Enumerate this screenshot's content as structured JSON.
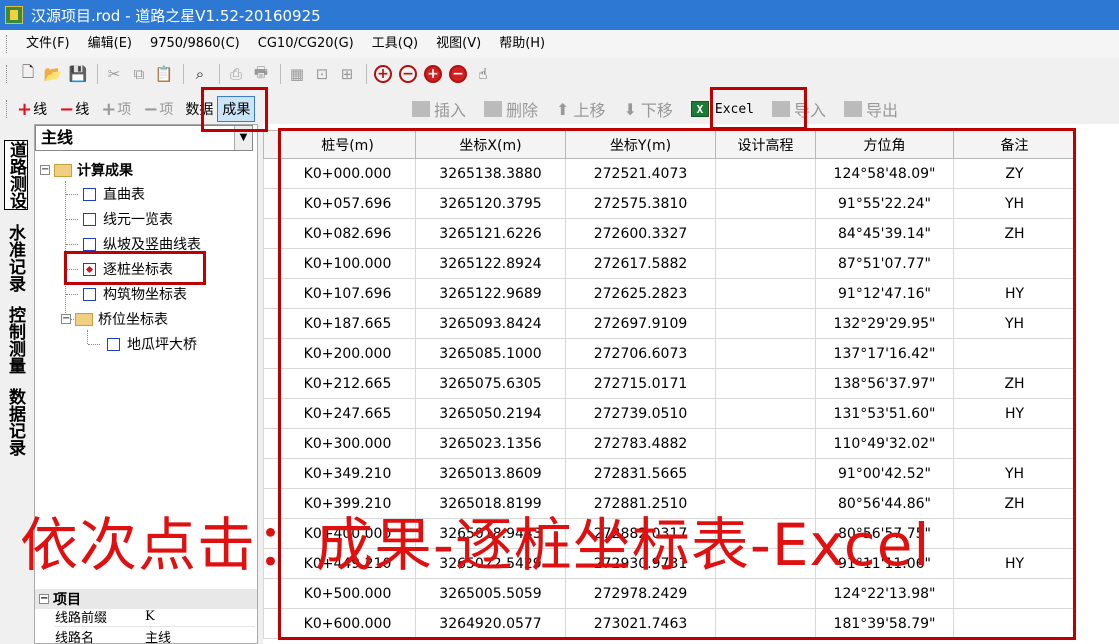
{
  "window": {
    "title": "汉源项目.rod - 道路之星V1.52-20160925"
  },
  "menu": [
    "文件(F)",
    "编辑(E)",
    "9750/9860(C)",
    "CG10/CG20(G)",
    "工具(Q)",
    "视图(V)",
    "帮助(H)"
  ],
  "toolbar2": {
    "add_line": "线",
    "del_line": "线",
    "add_item": "项",
    "del_item": "项",
    "data": "数据",
    "result": "成果",
    "insert": "插入",
    "delete": "删除",
    "move_up": "上移",
    "move_down": "下移",
    "excel": "Excel",
    "import": "导入",
    "export": "导出"
  },
  "vtabs": [
    "道路测设",
    "水准记录",
    "控制测量",
    "数据记录"
  ],
  "tree": {
    "combo_value": "主线",
    "root": "计算成果",
    "items": [
      "直曲表",
      "线元一览表",
      "纵坡及竖曲线表",
      "逐桩坐标表",
      "构筑物坐标表"
    ],
    "bridge_group": "桥位坐标表",
    "bridge_items": [
      "地瓜坪大桥"
    ]
  },
  "properties": {
    "header": "项目",
    "rows": [
      {
        "key": "线路前缀",
        "value": "K"
      },
      {
        "key": "线路名",
        "value": "主线"
      }
    ]
  },
  "table": {
    "columns": [
      "桩号(m)",
      "坐标X(m)",
      "坐标Y(m)",
      "设计高程",
      "方位角",
      "备注"
    ],
    "rows": [
      [
        "K0+000.000",
        "3265138.3880",
        "272521.4073",
        "",
        "124°58'48.09\"",
        "ZY"
      ],
      [
        "K0+057.696",
        "3265120.3795",
        "272575.3810",
        "",
        "91°55'22.24\"",
        "YH"
      ],
      [
        "K0+082.696",
        "3265121.6226",
        "272600.3327",
        "",
        "84°45'39.14\"",
        "ZH"
      ],
      [
        "K0+100.000",
        "3265122.8924",
        "272617.5882",
        "",
        "87°51'07.77\"",
        ""
      ],
      [
        "K0+107.696",
        "3265122.9689",
        "272625.2823",
        "",
        "91°12'47.16\"",
        "HY"
      ],
      [
        "K0+187.665",
        "3265093.8424",
        "272697.9109",
        "",
        "132°29'29.95\"",
        "YH"
      ],
      [
        "K0+200.000",
        "3265085.1000",
        "272706.6073",
        "",
        "137°17'16.42\"",
        ""
      ],
      [
        "K0+212.665",
        "3265075.6305",
        "272715.0171",
        "",
        "138°56'37.97\"",
        "ZH"
      ],
      [
        "K0+247.665",
        "3265050.2194",
        "272739.0510",
        "",
        "131°53'51.60\"",
        "HY"
      ],
      [
        "K0+300.000",
        "3265023.1356",
        "272783.4882",
        "",
        "110°49'32.02\"",
        ""
      ],
      [
        "K0+349.210",
        "3265013.8609",
        "272831.5665",
        "",
        "91°00'42.52\"",
        "YH"
      ],
      [
        "K0+399.210",
        "3265018.8199",
        "272881.2510",
        "",
        "80°56'44.86\"",
        "ZH"
      ],
      [
        "K0+400.000",
        "3265018.9443",
        "272882.0317",
        "",
        "80°56'57.75\"",
        ""
      ],
      [
        "K0+449.210",
        "3265022.5429",
        "272930.9731",
        "",
        "91°11'11.06\"",
        "HY"
      ],
      [
        "K0+500.000",
        "3265005.5059",
        "272978.2429",
        "",
        "124°22'13.98\"",
        ""
      ],
      [
        "K0+600.000",
        "3264920.0577",
        "273021.7463",
        "",
        "181°39'58.79\"",
        ""
      ]
    ]
  },
  "caption": "依次点击：成果-逐桩坐标表-Excel",
  "colors": {
    "titlebar": "#2d78d2",
    "annotation": "#c00000",
    "caption": "#e01010"
  }
}
